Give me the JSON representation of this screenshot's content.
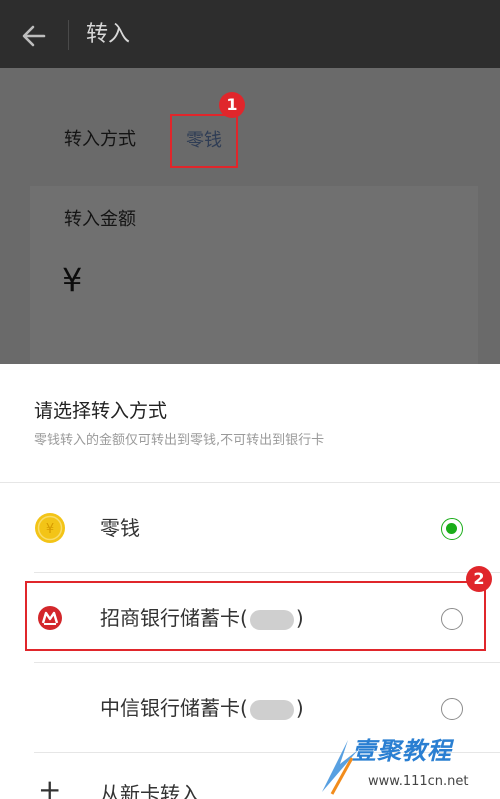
{
  "header": {
    "title": "转入"
  },
  "page": {
    "method_label": "转入方式",
    "method_value": "零钱",
    "amount_label": "转入金额",
    "amount_symbol": "¥"
  },
  "markers": [
    "1",
    "2"
  ],
  "sheet": {
    "title": "请选择转入方式",
    "note": "零钱转入的金额仅可转出到零钱,不可转出到银行卡",
    "options": [
      {
        "label": "零钱",
        "selected": true,
        "icon": "coin-icon"
      },
      {
        "label_prefix": "招商银行储蓄卡(",
        "label_suffix": ")",
        "selected": false,
        "icon": "cmb-bank-icon"
      },
      {
        "label_prefix": "中信银行储蓄卡(",
        "label_suffix": ")",
        "selected": false,
        "icon": "none"
      }
    ],
    "add_card": {
      "label": "从新卡转入",
      "icon": "plus-icon"
    }
  },
  "watermark": {
    "text": "壹聚教程",
    "url": "www.111cn.net"
  },
  "colors": {
    "annotation_red": "#e0262b",
    "selected_green": "#1aad19",
    "topbar": "#2d2d2d",
    "overlay": "#6b6b6b"
  }
}
